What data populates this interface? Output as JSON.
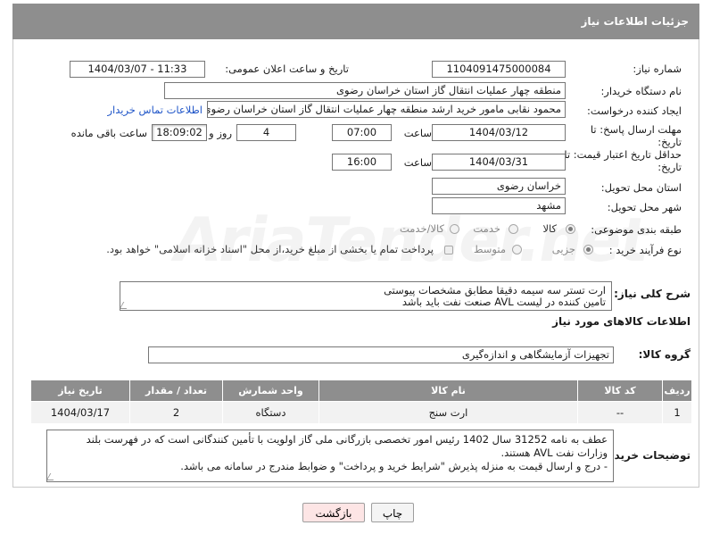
{
  "header": {
    "title": "جزئیات اطلاعات نیاز"
  },
  "fields": {
    "need_number_label": "شماره نیاز:",
    "need_number": "1104091475000084",
    "announce_label": "تاریخ و ساعت اعلان عمومی:",
    "announce_value": "1404/03/07 - 11:33",
    "buyer_org_label": "نام دستگاه خریدار:",
    "buyer_org": "منطقه چهار عملیات انتقال گاز   استان خراسان رضوی",
    "creator_label": "ایجاد کننده درخواست:",
    "creator": "محمود نقابی مامور خرید ارشد منطقه چهار عملیات انتقال گاز   استان خراسان رضوی",
    "contact_link": "اطلاعات تماس خریدار",
    "reply_deadline_label": "مهلت ارسال پاسخ: تا تاریخ:",
    "reply_date": "1404/03/12",
    "time_label": "ساعت",
    "reply_time": "07:00",
    "days_count": "4",
    "days_and_label": "روز و",
    "remaining_time": "18:09:02",
    "remaining_label": "ساعت باقی مانده",
    "price_validity_label": "حداقل تاریخ اعتبار قیمت: تا تاریخ:",
    "price_date": "1404/03/31",
    "price_time": "16:00",
    "delivery_province_label": "استان محل تحویل:",
    "delivery_province": "خراسان رضوی",
    "delivery_city_label": "شهر محل تحویل:",
    "delivery_city": "مشهد",
    "category_label": "طبقه بندی موضوعی:",
    "category_options": [
      "کالا",
      "خدمت",
      "کالا/خدمت"
    ],
    "process_label": "نوع فرآیند خرید :",
    "process_options": [
      "جزیی",
      "متوسط"
    ],
    "payment_note": "پرداخت تمام یا بخشی از مبلغ خرید،از محل \"اسناد خزانه اسلامی\" خواهد بود."
  },
  "description": {
    "label": "شرح کلی نیاز:",
    "lines": [
      "ارت تستر سه سیمه دقیقا مطابق مشخصات پیوستی",
      "تامین کننده در لیست AVL صنعت نفت باید باشد"
    ]
  },
  "goods_info_title": "اطلاعات کالاهای مورد نیاز",
  "goods_group": {
    "label": "گروه کالا:",
    "value": "تجهیزات آزمایشگاهی و اندازه‌گیری"
  },
  "table": {
    "headers": [
      "ردیف",
      "کد کالا",
      "نام کالا",
      "واحد شمارش",
      "تعداد / مقدار",
      "تاریخ نیاز"
    ],
    "rows": [
      [
        "1",
        "--",
        "ارت سنج",
        "دستگاه",
        "2",
        "1404/03/17"
      ]
    ]
  },
  "buyer_notes": {
    "label": "توضیحات خریدار:",
    "lines": [
      "عطف به نامه 31252 سال 1402 رئیس امور تخصصی بازرگانی ملی گاز اولویت با تأمین کنندگانی است که در فهرست بلند",
      "وزارات نفت AVL هستند.",
      "- درج و ارسال قیمت به منزله پذیرش \"شرایط خرید و پرداخت\" و ضوابط مندرج در سامانه می باشد."
    ]
  },
  "buttons": {
    "print": "چاپ",
    "back": "بازگشت"
  },
  "watermark": "AriaTender.net",
  "colors": {
    "header_bg": "#8e8e8e",
    "link": "#1f55c8",
    "back_button_bg": "#fde5e5"
  }
}
